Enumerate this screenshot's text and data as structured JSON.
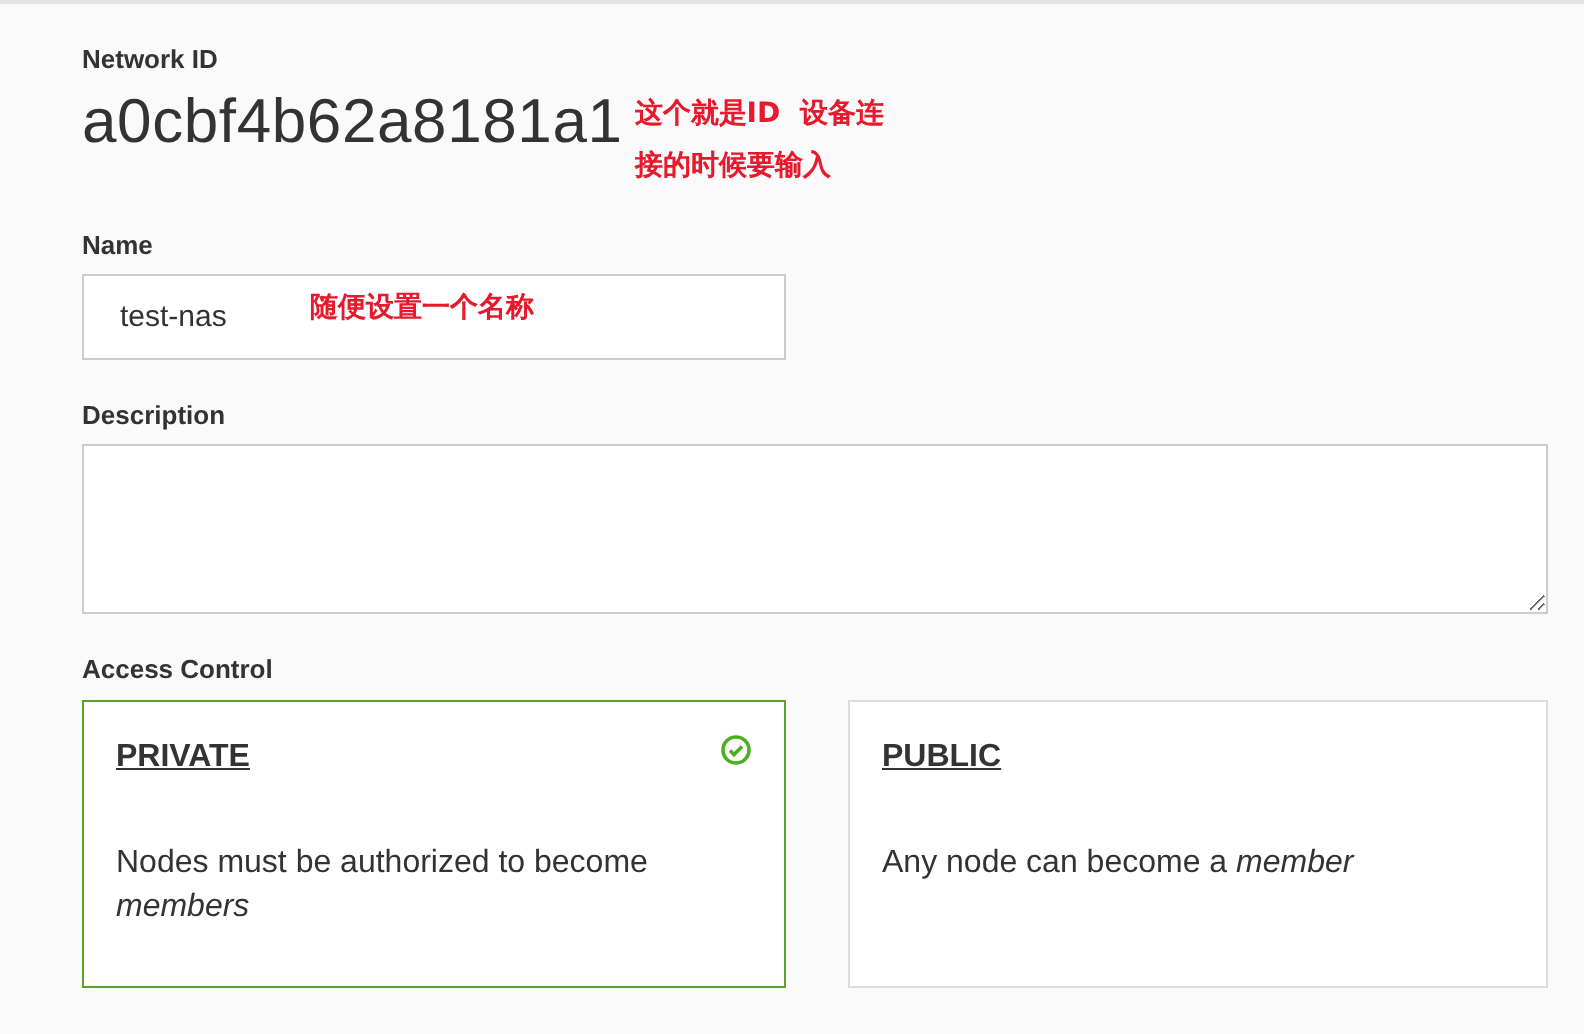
{
  "network_id": {
    "label": "Network ID",
    "value": "a0cbf4b62a8181a1",
    "annotation": [
      "这个就是ID  设备连",
      "接的时候要输入"
    ]
  },
  "name": {
    "label": "Name",
    "value": "test-nas",
    "annotation": "随便设置一个名称"
  },
  "description": {
    "label": "Description"
  },
  "access_control": {
    "label": "Access Control",
    "options": [
      {
        "title": "PRIVATE",
        "text": "Nodes must be authorized to become *members*",
        "selected": true
      },
      {
        "title": "PUBLIC",
        "text": "Any node can become a *member*",
        "selected": false
      }
    ]
  }
}
